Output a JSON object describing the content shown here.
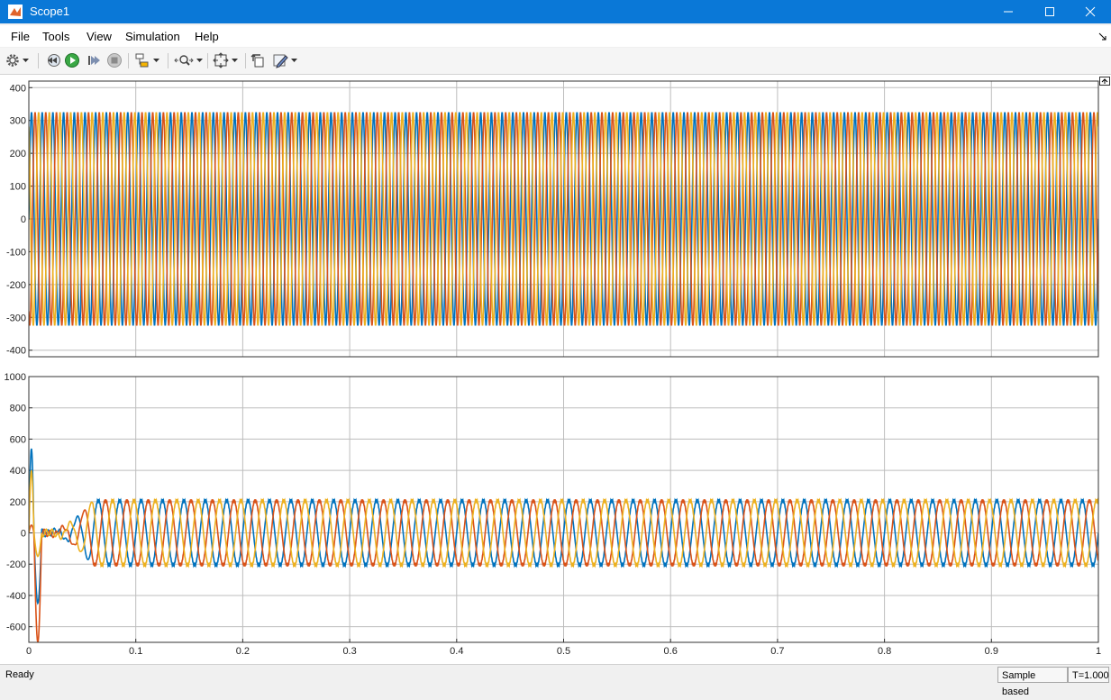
{
  "window": {
    "title": "Scope1"
  },
  "menu": [
    "File",
    "Tools",
    "View",
    "Simulation",
    "Help"
  ],
  "toolbar": {
    "icons": [
      "gear-icon",
      "step-back-icon",
      "run-icon",
      "step-forward-icon",
      "stop-icon",
      "highlight-block-icon",
      "zoom-icon",
      "autoscale-icon",
      "restore-layout-icon",
      "style-icon"
    ]
  },
  "status": {
    "text": "Ready",
    "mode": "Sample based",
    "time": "T=1.000"
  },
  "colors": {
    "series_blue": "#0072bd",
    "series_orange": "#d95319",
    "series_yellow": "#edb120",
    "titlebar": "#0a78d7"
  },
  "chart_data": [
    {
      "type": "line",
      "xlim": [
        0,
        1
      ],
      "ylim": [
        -420,
        420
      ],
      "y_ticks": [
        "400",
        "300",
        "200",
        "100",
        "0",
        "-100",
        "-200",
        "-300",
        "-400"
      ],
      "grid": true,
      "frequency_hz": 100,
      "series": [
        {
          "color": "#0072bd",
          "amplitude": 325,
          "phase_deg": 0
        },
        {
          "color": "#d95319",
          "amplitude": 325,
          "phase_deg": -120
        },
        {
          "color": "#edb120",
          "amplitude": 325,
          "phase_deg": 120
        }
      ]
    },
    {
      "type": "line",
      "xlim": [
        0,
        1
      ],
      "ylim": [
        -700,
        1000
      ],
      "x_ticks": [
        "0",
        "0.1",
        "0.2",
        "0.3",
        "0.4",
        "0.5",
        "0.6",
        "0.7",
        "0.8",
        "0.9",
        "1"
      ],
      "y_ticks": [
        "1000",
        "800",
        "600",
        "400",
        "200",
        "0",
        "-200",
        "-400",
        "-600"
      ],
      "grid": true,
      "frequency_hz": 50,
      "steady_start": 0.06,
      "steady_amplitude": 210,
      "series": [
        {
          "color": "#0072bd",
          "phase_deg": 0,
          "initial_peak": 540,
          "initial_min": -450
        },
        {
          "color": "#d95319",
          "phase_deg": -120,
          "initial_peak": 50,
          "initial_min": -700
        },
        {
          "color": "#edb120",
          "phase_deg": 120,
          "initial_peak": 400,
          "initial_min": -150
        }
      ]
    }
  ]
}
